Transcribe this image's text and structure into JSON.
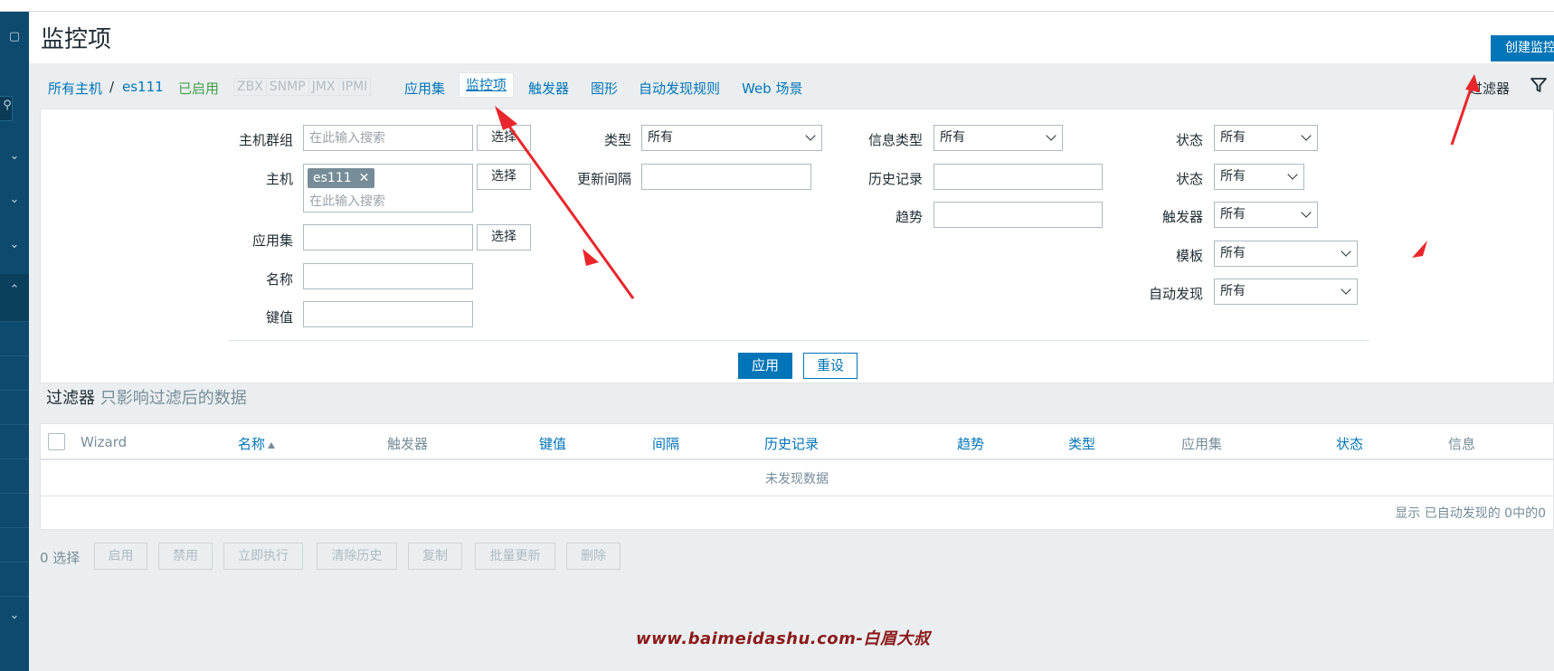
{
  "header": {
    "title": "监控项",
    "create_button": "创建监控项"
  },
  "nav": {
    "all_hosts": "所有主机",
    "separator": "/",
    "host": "es111",
    "status": "已启用",
    "protocols": [
      "ZBX",
      "SNMP",
      "JMX",
      "IPMI"
    ],
    "tabs": [
      "应用集",
      "监控项",
      "触发器",
      "图形",
      "自动发现规则",
      "Web 场景"
    ],
    "filter_tab": "过滤器"
  },
  "filter": {
    "host_group_label": "主机群组",
    "host_group_placeholder": "在此输入搜索",
    "host_label": "主机",
    "host_chip": "es111",
    "host_placeholder": "在此输入搜索",
    "app_label": "应用集",
    "name_label": "名称",
    "key_label": "键值",
    "select_button": "选择",
    "type_label": "类型",
    "type_value": "所有",
    "interval_label": "更新间隔",
    "info_type_label": "信息类型",
    "info_type_value": "所有",
    "history_label": "历史记录",
    "trend_label": "趋势",
    "state_label": "状态",
    "state_value": "所有",
    "status_label": "状态",
    "status_value": "所有",
    "trigger_label": "触发器",
    "trigger_value": "所有",
    "template_label": "模板",
    "template_value": "所有",
    "discovery_label": "自动发现",
    "discovery_value": "所有",
    "apply_button": "应用",
    "reset_button": "重设"
  },
  "filter_note": {
    "title": "过滤器",
    "subtitle": "只影响过滤后的数据"
  },
  "table": {
    "columns": {
      "wizard": "Wizard",
      "name": "名称",
      "triggers": "触发器",
      "key": "键值",
      "interval": "间隔",
      "history": "历史记录",
      "trends": "趋势",
      "type": "类型",
      "applications": "应用集",
      "status": "状态",
      "info": "信息"
    },
    "no_data": "未发现数据",
    "paging": "显示 已自动发现的 0中的0"
  },
  "actions": {
    "selected": "0 选择",
    "enable": "启用",
    "disable": "禁用",
    "execute_now": "立即执行",
    "clear_history": "清除历史",
    "copy": "复制",
    "mass_update": "批量更新",
    "delete": "删除"
  },
  "watermark": "www.baimeidashu.com-白眉大叔",
  "colors": {
    "accent": "#0275b8",
    "sidebar": "#0e4a6d",
    "enabled": "#429e47",
    "annotation": "#e8262b"
  }
}
